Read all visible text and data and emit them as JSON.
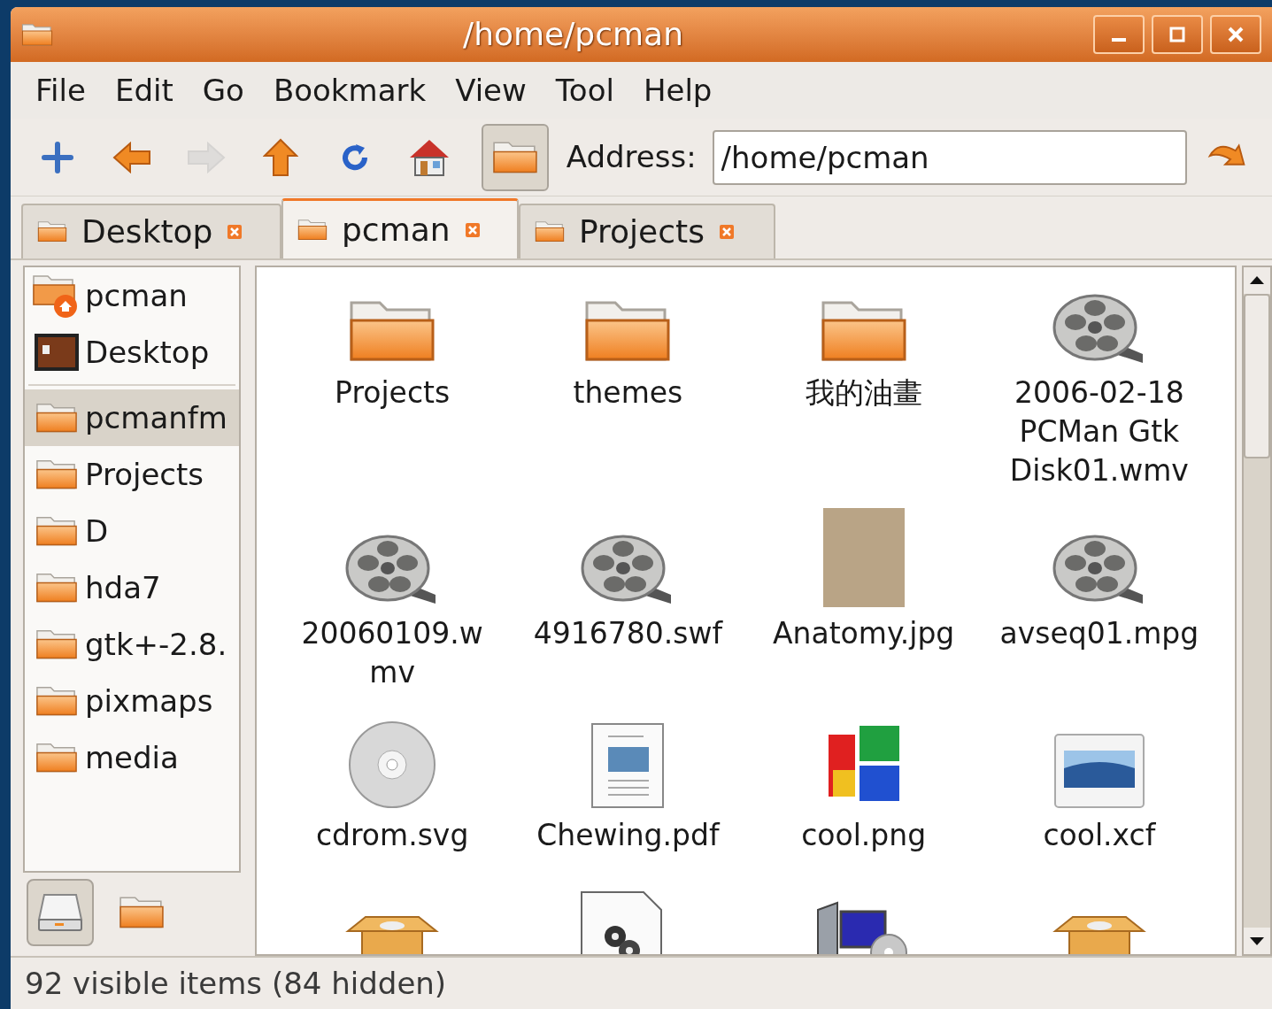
{
  "window": {
    "title": "/home/pcman",
    "controls": [
      {
        "kind": "minimize"
      },
      {
        "kind": "maximize"
      },
      {
        "kind": "close"
      }
    ]
  },
  "menu": [
    "File",
    "Edit",
    "Go",
    "Bookmark",
    "View",
    "Tool",
    "Help"
  ],
  "toolbar": {
    "buttons": [
      {
        "kind": "new-tab",
        "disabled": false,
        "pressed": false
      },
      {
        "kind": "back",
        "disabled": false,
        "pressed": false
      },
      {
        "kind": "forward",
        "disabled": true,
        "pressed": false
      },
      {
        "kind": "up",
        "disabled": false,
        "pressed": false
      },
      {
        "kind": "reload",
        "disabled": false,
        "pressed": false
      },
      {
        "kind": "home",
        "disabled": false,
        "pressed": false
      },
      {
        "kind": "folder-view",
        "disabled": false,
        "pressed": true
      }
    ],
    "address_label": "Address:",
    "address": "/home/pcman"
  },
  "tabs": [
    {
      "label": "Desktop",
      "selected": false
    },
    {
      "label": "pcman",
      "selected": true
    },
    {
      "label": "Projects",
      "selected": false
    }
  ],
  "sidebar": {
    "places": [
      {
        "label": "pcman",
        "kind": "home",
        "selected": false
      },
      {
        "label": "Desktop",
        "kind": "desktop",
        "selected": false
      }
    ],
    "bookmarks": [
      {
        "label": "pcmanfm",
        "kind": "folder",
        "selected": true
      },
      {
        "label": "Projects",
        "kind": "folder",
        "selected": false
      },
      {
        "label": "D",
        "kind": "folder",
        "selected": false
      },
      {
        "label": "hda7",
        "kind": "folder",
        "selected": false
      },
      {
        "label": "gtk+-2.8.",
        "kind": "folder",
        "selected": false
      },
      {
        "label": "pixmaps",
        "kind": "folder",
        "selected": false
      },
      {
        "label": "media",
        "kind": "folder",
        "selected": false
      }
    ],
    "modes": [
      {
        "kind": "drive",
        "selected": true
      },
      {
        "kind": "folder",
        "selected": false
      }
    ]
  },
  "files": [
    {
      "name": "Projects",
      "kind": "folder"
    },
    {
      "name": "themes",
      "kind": "folder"
    },
    {
      "name": "我的油畫",
      "kind": "folder"
    },
    {
      "name": "2006-02-18 PCMan Gtk Disk01.wmv",
      "kind": "video"
    },
    {
      "name": "20060109.wmv",
      "kind": "video"
    },
    {
      "name": "4916780.swf",
      "kind": "video"
    },
    {
      "name": "Anatomy.jpg",
      "kind": "photo"
    },
    {
      "name": "avseq01.mpg",
      "kind": "video"
    },
    {
      "name": "cdrom.svg",
      "kind": "disc"
    },
    {
      "name": "Chewing.pdf",
      "kind": "document"
    },
    {
      "name": "cool.png",
      "kind": "glyph-image"
    },
    {
      "name": "cool.xcf",
      "kind": "picture"
    },
    {
      "kind": "package"
    },
    {
      "kind": "source"
    },
    {
      "kind": "computer"
    },
    {
      "kind": "package"
    }
  ],
  "status_bar": "92 visible items (84 hidden)"
}
